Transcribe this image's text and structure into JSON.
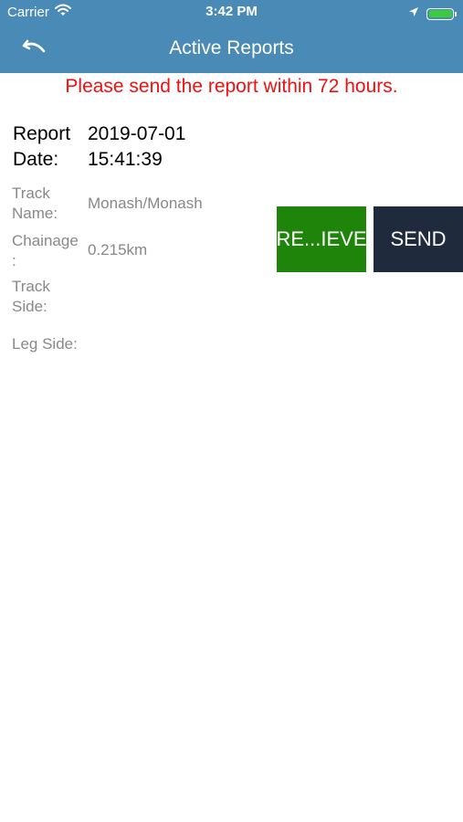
{
  "status_bar": {
    "carrier": "Carrier",
    "time": "3:42 PM",
    "battery_level": 1.0,
    "icons": [
      "wifi-icon",
      "location-arrow-icon",
      "battery-icon"
    ]
  },
  "nav": {
    "title": "Active Reports",
    "back_icon": "undo-arrow-icon"
  },
  "warning": {
    "text": "Please send the report within 72 hours."
  },
  "report": {
    "date_label_line1": "Report",
    "date_label_line2": "Date:",
    "date_value_line1": "2019-07-01",
    "date_value_line2": "15:41:39",
    "track_name_label_line1": "Track",
    "track_name_label_line2": "Name:",
    "track_name_value": "Monash/Monash",
    "chainage_label_line1": "Chainage",
    "chainage_label_line2": ":",
    "chainage_value": "0.215km",
    "track_side_label_line1": "Track",
    "track_side_label_line2": "Side:",
    "track_side_value": "",
    "leg_side_label": "Leg Side:",
    "leg_side_value": ""
  },
  "actions": {
    "retrieve_label": "RE...IEVE",
    "send_label": "SEND"
  },
  "colors": {
    "header_bg": "#4a8ab6",
    "warning_text": "#ee1111",
    "retrieve_bg": "#1f850a",
    "send_bg": "#1f2b3d",
    "label_grey": "#888888",
    "battery_green": "#3ccb3c"
  }
}
